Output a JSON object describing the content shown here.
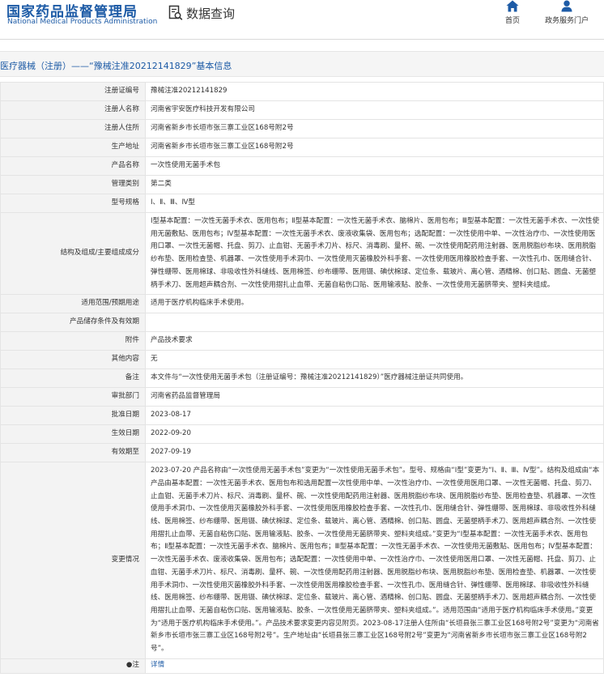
{
  "site": {
    "name_cn": "国家药品监督管理局",
    "name_en": "National Medical Products Administration",
    "query_label": "数据查询",
    "nav": [
      {
        "label": "首页",
        "icon": "home-icon"
      },
      {
        "label": "政务服务门户",
        "icon": "user-icon"
      }
    ],
    "brand_color": "#1d5ba6"
  },
  "page_title": "医疗器械（注册）——“豫械注准20212141829”基本信息",
  "fields": [
    {
      "key": "注册证编号",
      "value": "豫械注准20212141829"
    },
    {
      "key": "注册人名称",
      "value": "河南省宇安医疗科技开发有限公司"
    },
    {
      "key": "注册人住所",
      "value": "河南省新乡市长垣市张三寨工业区168号附2号"
    },
    {
      "key": "生产地址",
      "value": "河南省新乡市长垣市张三寨工业区168号附2号"
    },
    {
      "key": "产品名称",
      "value": "一次性使用无菌手术包"
    },
    {
      "key": "管理类别",
      "value": "第二类"
    },
    {
      "key": "型号规格",
      "value": "Ⅰ、Ⅱ、Ⅲ、Ⅳ型"
    },
    {
      "key": "结构及组成/主要组成成分",
      "value": "Ⅰ型基本配置：一次性无菌手术衣、医用包布；Ⅱ型基本配置：一次性无菌手术衣、脑棉片、医用包布；Ⅲ型基本配置：一次性无菌手术衣、一次性使用无菌敷贴、医用包布；Ⅳ型基本配置：一次性无菌手术衣、废液收集袋、医用包布；选配配置：一次性使用中单、一次性治疗巾、一次性使用医用口罩、一次性无菌帽、托盘、剪刀、止血钳、无菌手术刀片、标尺、消毒刷、量杯、碗、一次性使用配药用注射器、医用脱脂纱布块、医用脱脂纱布垫、医用检查垫、机器罩、一次性使用手术洞巾、一次性使用灭菌橡胶外科手套、一次性使用医用橡胶检查手套、一次性孔巾、医用缝合针、弹性绷带、医用棉球、非吸收性外科缝线、医用棉签、纱布绷带、医用镊、碘伏棉球、定位条、载玻片、离心管、酒精棉、创口贴、圆盘、无菌塑柄手术刀、医用超声耦合剂、一次性使用摺扎止血带、无菌自粘伤口贴、医用输液贴、胶条、一次性使用无菌脐带夹、塑料夹组成。"
    },
    {
      "key": "适用范围/预期用途",
      "value": "适用于医疗机构临床手术使用。"
    },
    {
      "key": "产品储存条件及有效期",
      "value": ""
    },
    {
      "key": "附件",
      "value": "产品技术要求"
    },
    {
      "key": "其他内容",
      "value": "无"
    },
    {
      "key": "备注",
      "value": "本文件与“一次性使用无菌手术包（注册证编号：豫械注准20212141829）”医疗器械注册证共同使用。"
    },
    {
      "key": "审批部门",
      "value": "河南省药品监督管理局"
    },
    {
      "key": "批准日期",
      "value": "2023-08-17"
    },
    {
      "key": "生效日期",
      "value": "2022-09-20"
    },
    {
      "key": "有效期至",
      "value": "2027-09-19"
    },
    {
      "key": "变更情况",
      "value": "2023-07-20 产品名称由“一次性使用无菌手术包”变更为“一次性使用无菌手术包”。型号、规格由“Ⅰ型”变更为“Ⅰ、Ⅱ、Ⅲ、Ⅳ型”。结构及组成由“本产品由基本配置：一次性无菌手术衣、医用包布和选用配置一次性使用中单、一次性治疗巾、一次性使用医用口罩、一次性无菌帽、托盘、剪刀、止血钳、无菌手术刀片、标尺、消毒刷、量杯、碗、一次性使用配药用注射器、医用脱脂纱布块、医用脱脂纱布垫、医用检查垫、机器罩、一次性使用手术洞巾、一次性使用灭菌橡胶外科手套、一次性使用医用橡胶检查手套、一次性孔巾、医用缝合针、弹性绷带、医用棉球、非吸收性外科缝线、医用棉签、纱布绷带、医用镊、碘伏棉球、定位条、载玻片、离心管、酒精棉、创口贴、圆盘、无菌塑柄手术刀、医用超声耦合剂、一次性使用摺扎止血带、无菌自粘伤口贴、医用输液贴、胶条、一次性使用无菌脐带夹、塑料夹组成。”变更为“Ⅰ型基本配置：一次性无菌手术衣、医用包布；Ⅱ型基本配置：一次性无菌手术衣、脑棉片、医用包布；Ⅲ型基本配置：一次性无菌手术衣、一次性使用无菌敷贴、医用包布；Ⅳ型基本配置：一次性无菌手术衣、废液收集袋、医用包布；选配配置：一次性使用中单、一次性治疗巾、一次性使用医用口罩、一次性无菌帽、托盘、剪刀、止血钳、无菌手术刀片、标尺、消毒刷、量杯、碗、一次性使用配药用注射器、医用脱脂纱布块、医用脱脂纱布垫、医用检查垫、机器罩、一次性使用手术洞巾、一次性使用灭菌橡胶外科手套、一次性使用医用橡胶检查手套、一次性孔巾、医用缝合针、弹性绷带、医用棉球、非吸收性外科缝线、医用棉签、纱布绷带、医用镊、碘伏棉球、定位条、载玻片、离心管、酒精棉、创口贴、圆盘、无菌塑柄手术刀、医用超声耦合剂、一次性使用摺扎止血带、无菌自粘伤口贴、医用输液贴、胶条、一次性使用无菌脐带夹、塑料夹组成。”。适用范围由“适用于医疗机构临床手术使用。”变更为“适用于医疗机构临床手术使用。”。产品技术要求变更内容见附页。2023-08-17注册人住所由“长垣县张三寨工业区168号附2号”变更为“河南省新乡市长垣市张三寨工业区168号附2号”。生产地址由“长垣县张三寨工业区168号附2号”变更为“河南省新乡市长垣市张三寨工业区168号附2号”。"
    }
  ],
  "note": {
    "key": "●注",
    "link_label": "详情"
  }
}
